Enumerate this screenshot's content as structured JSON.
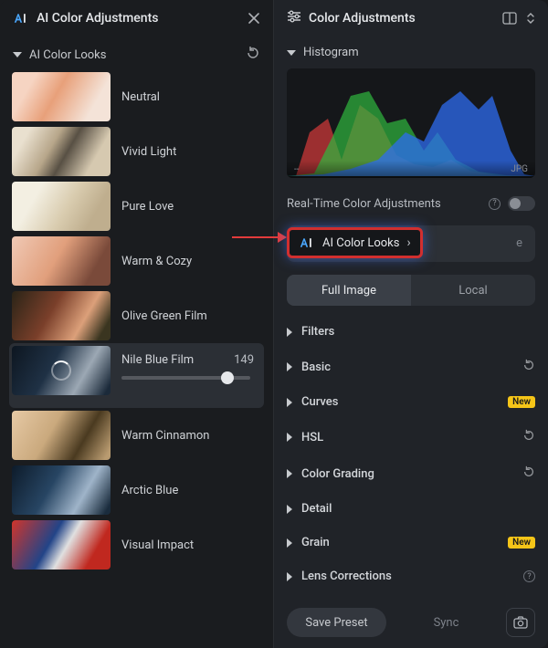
{
  "left": {
    "title": "AI Color Adjustments",
    "section": "AI Color Looks",
    "looks": [
      {
        "label": "Neutral"
      },
      {
        "label": "Vivid Light"
      },
      {
        "label": "Pure Love"
      },
      {
        "label": "Warm & Cozy"
      },
      {
        "label": "Olive Green Film"
      },
      {
        "label": "Nile Blue Film",
        "value": "149",
        "active": true,
        "slider_pct": 82
      },
      {
        "label": "Warm Cinnamon"
      },
      {
        "label": "Arctic Blue"
      },
      {
        "label": "Visual Impact"
      }
    ]
  },
  "right": {
    "title": "Color Adjustments",
    "histogram_section": "Histogram",
    "histogram_left": "--",
    "histogram_right": "JPG",
    "realtime_label": "Real-Time Color Adjustments",
    "callout_label": "AI Color Looks",
    "callout_suffix": "e",
    "tabs": {
      "full": "Full Image",
      "local": "Local"
    },
    "sections": [
      {
        "name": "Filters"
      },
      {
        "name": "Basic",
        "reset": true
      },
      {
        "name": "Curves",
        "badge": "New"
      },
      {
        "name": "HSL",
        "reset": true
      },
      {
        "name": "Color Grading",
        "reset": true
      },
      {
        "name": "Detail"
      },
      {
        "name": "Grain",
        "badge": "New"
      },
      {
        "name": "Lens Corrections",
        "info": true
      }
    ],
    "save_preset": "Save Preset",
    "sync": "Sync"
  }
}
